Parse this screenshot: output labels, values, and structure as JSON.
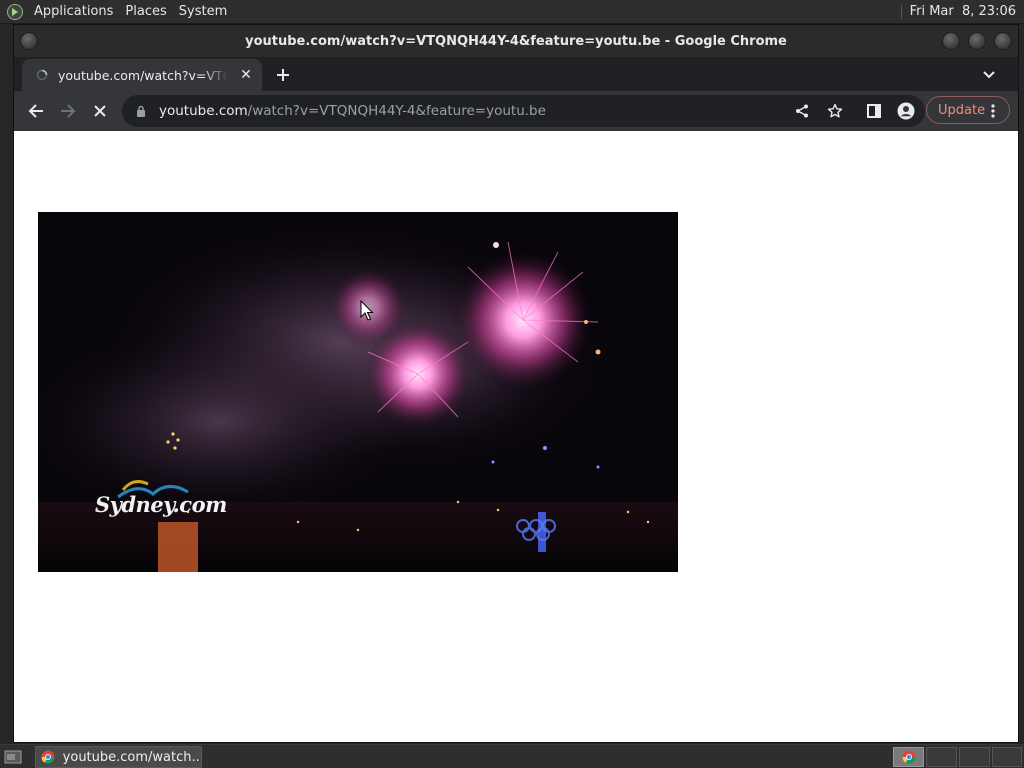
{
  "top_panel": {
    "menus": [
      "Applications",
      "Places",
      "System"
    ],
    "clock": "Fri Mar  8, 23:06"
  },
  "window": {
    "title": "youtube.com/watch?v=VTQNQH44Y-4&feature=youtu.be - Google Chrome"
  },
  "tabs": [
    {
      "title": "youtube.com/watch?v=VTQNQH44Y-4&feature=youtu.be",
      "favicon": "loading-spinner-icon"
    }
  ],
  "toolbar": {
    "url_host": "youtube.com",
    "url_path": "/watch?v=VTQNQH44Y-4&feature=youtu.be",
    "update_label": "Update",
    "icons": [
      "back-icon",
      "forward-icon",
      "stop-icon",
      "lock-icon",
      "share-icon",
      "bookmark-star-icon",
      "side-panel-icon",
      "profile-icon",
      "menu-dots-icon"
    ]
  },
  "video": {
    "watermark": "Sydney.com"
  },
  "taskbar": {
    "task_label": "youtube.com/watch..."
  },
  "colors": {
    "update_accent": "#f28b82",
    "chrome_dark": "#35363a",
    "panel": "#2e2e2e"
  }
}
